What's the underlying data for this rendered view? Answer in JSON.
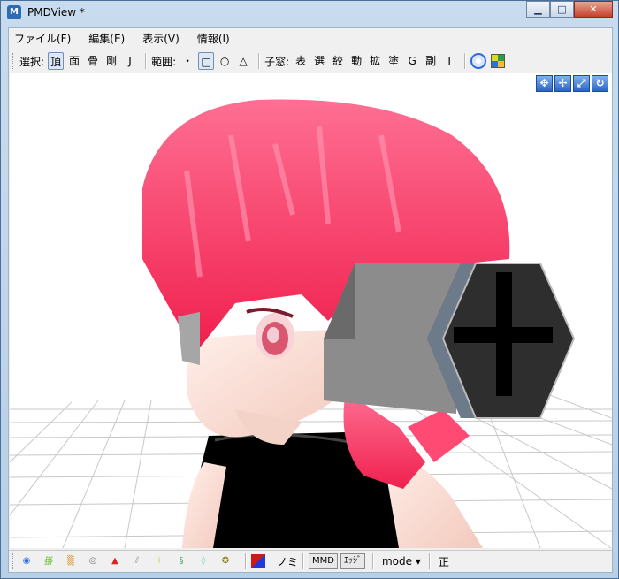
{
  "window": {
    "title": "PMDView *",
    "minimize": "▁",
    "maximize": "□",
    "close": "✕"
  },
  "menu": [
    "ファイル(F)",
    "編集(E)",
    "表示(V)",
    "情報(I)"
  ],
  "toolbar": {
    "select_label": "選択:",
    "select_buttons": [
      "頂",
      "面",
      "骨",
      "剛",
      "J"
    ],
    "range_label": "範囲:",
    "range_buttons": [
      "・",
      "□",
      "○",
      "△"
    ],
    "child_label": "子窓:",
    "child_buttons": [
      "表",
      "選",
      "絞",
      "動",
      "拡",
      "塗",
      "G",
      "副",
      "T"
    ]
  },
  "nav_icons": [
    "move-xy-icon",
    "move-xz-icon",
    "zoom-icon",
    "rotate-icon"
  ],
  "statusbar": {
    "mode_label": "mode ▾",
    "nomi_label": "ノミ",
    "mmd_label": "MMD",
    "edge_label": "ｴｯｼﾞ",
    "sei_label": "正"
  },
  "colors": {
    "hair": "#ff3366",
    "headphone": "#8c8c8c",
    "shirt": "#000000",
    "skin": "#ffe4dc"
  }
}
